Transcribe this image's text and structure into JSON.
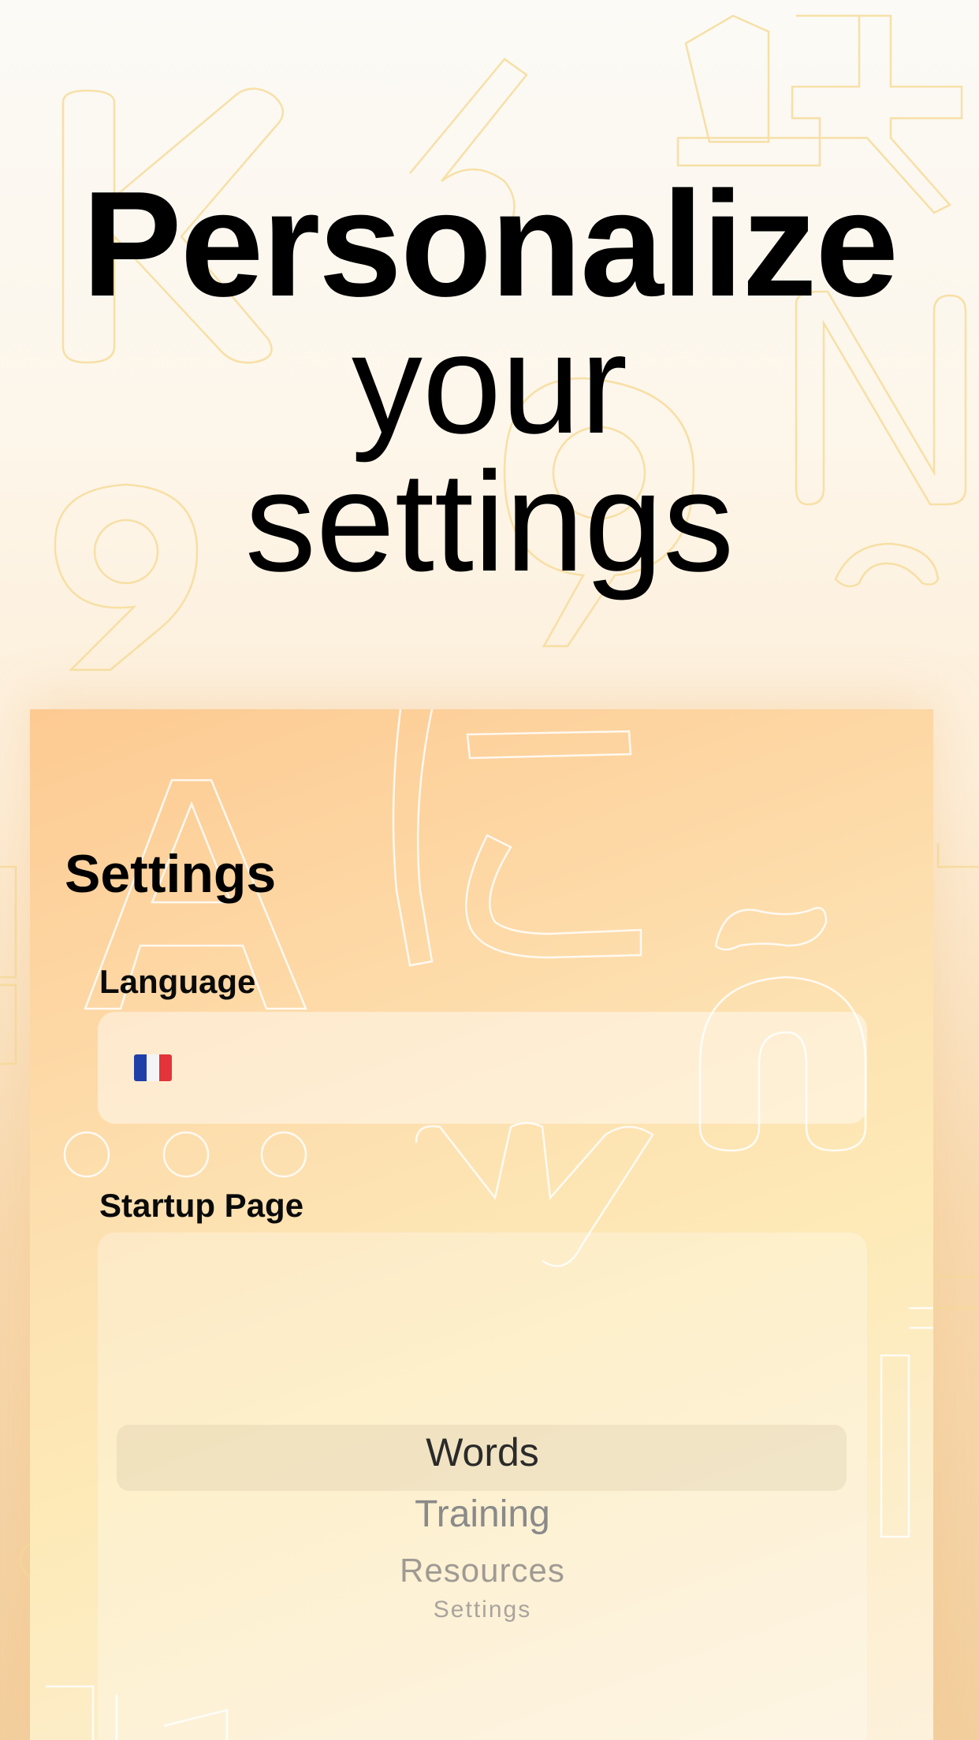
{
  "headline": {
    "line1": "Personalize",
    "line2": "your",
    "line3": "settings"
  },
  "settings": {
    "title": "Settings",
    "language": {
      "label": "Language",
      "selected_flag": "france-flag-icon"
    },
    "startup_page": {
      "label": "Startup Page",
      "options": [
        "Words",
        "Training",
        "Resources",
        "Settings"
      ],
      "selected": "Words"
    }
  },
  "colors": {
    "background_top": "#fbfaf6",
    "card_accent": "#fdca92",
    "outline_letters": "#f6d98a"
  }
}
